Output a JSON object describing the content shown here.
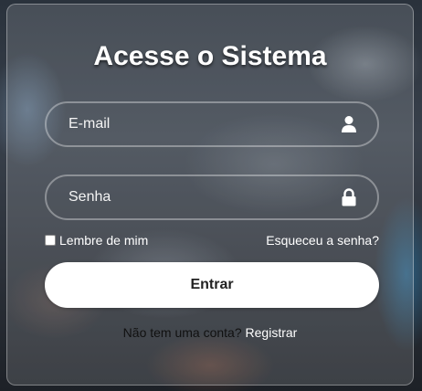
{
  "login": {
    "title": "Acesse o Sistema",
    "email": {
      "placeholder": "E-mail",
      "value": "",
      "icon": "user-icon"
    },
    "password": {
      "placeholder": "Senha",
      "value": "",
      "icon": "lock-icon"
    },
    "remember_label": "Lembre de mim",
    "remember_checked": false,
    "forgot_label": "Esqueceu a senha?",
    "submit_label": "Entrar",
    "no_account_text": "Não tem uma conta?",
    "register_label": "Registrar"
  }
}
